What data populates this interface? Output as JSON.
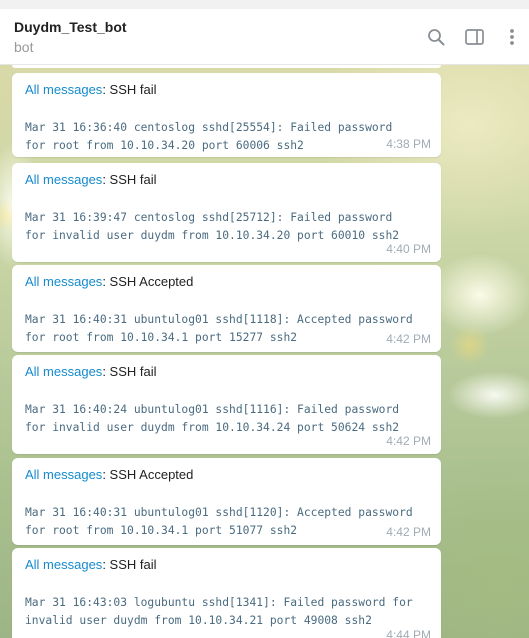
{
  "header": {
    "title": "Duydm_Test_bot",
    "subtitle": "bot"
  },
  "messages": [
    {
      "link": "All messages",
      "sep": ": ",
      "subject": "SSH fail",
      "line1": "Mar 31 16:36:40 centoslog sshd[25554]: Failed password",
      "line2": "for root from 10.10.34.20 port 60006 ssh2",
      "time": "4:38 PM"
    },
    {
      "link": "All messages",
      "sep": ": ",
      "subject": "SSH fail",
      "line1": "Mar 31 16:39:47 centoslog sshd[25712]: Failed password",
      "line2": "for invalid user duydm from 10.10.34.20 port 60010 ssh2",
      "time": "4:40 PM"
    },
    {
      "link": "All messages",
      "sep": ": ",
      "subject": "SSH Accepted",
      "line1": "Mar 31 16:40:31 ubuntulog01 sshd[1118]: Accepted password",
      "line2": "for root from 10.10.34.1 port 15277 ssh2",
      "time": "4:42 PM"
    },
    {
      "link": "All messages",
      "sep": ": ",
      "subject": "SSH fail",
      "line1": "Mar 31 16:40:24 ubuntulog01 sshd[1116]: Failed password",
      "line2": "for invalid user duydm from 10.10.34.24 port 50624 ssh2",
      "time": "4:42 PM"
    },
    {
      "link": "All messages",
      "sep": ": ",
      "subject": "SSH Accepted",
      "line1": "Mar 31 16:40:31 ubuntulog01 sshd[1120]: Accepted password",
      "line2": "for root from 10.10.34.1 port 51077 ssh2",
      "time": "4:42 PM"
    },
    {
      "link": "All messages",
      "sep": ": ",
      "subject": "SSH fail",
      "line1": "Mar 31 16:43:03 logubuntu sshd[1341]: Failed password for",
      "line2": "invalid user duydm from 10.10.34.21 port 49008 ssh2",
      "time": "4:44 PM"
    }
  ],
  "icons": {
    "search": "search-icon",
    "sidebar": "sidebar-toggle-icon",
    "more": "more-vertical-icon"
  }
}
